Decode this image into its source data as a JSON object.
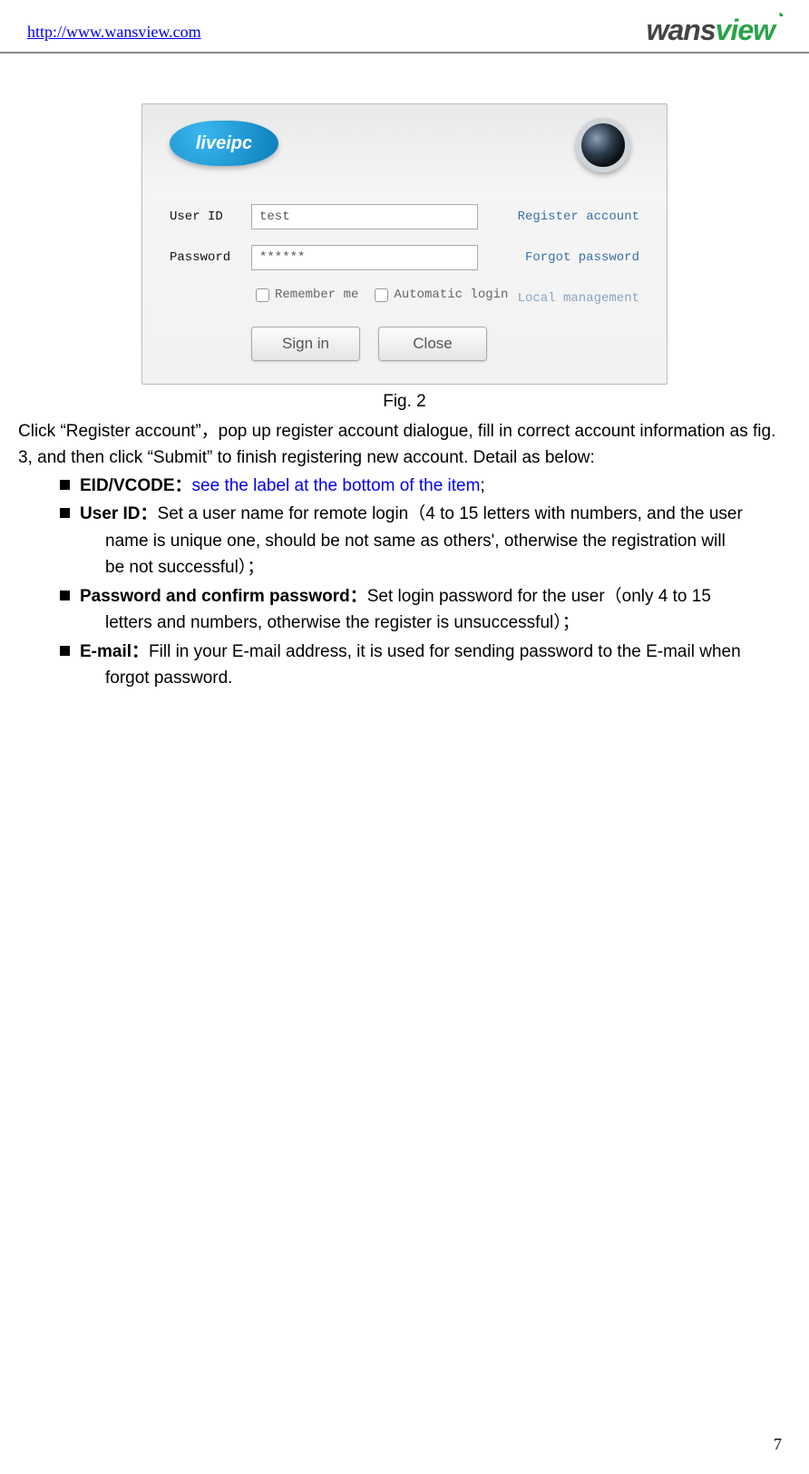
{
  "header": {
    "url": "http://www.wansview.com",
    "brand_prefix": "wans",
    "brand_suffix": "view"
  },
  "login": {
    "badge": "liveipc",
    "user_label": "User  ID",
    "user_value": "test",
    "pass_label": "Password",
    "pass_value": "******",
    "register_link": "Register account",
    "forgot_link": "Forgot password",
    "remember": "Remember me",
    "auto": "Automatic login",
    "local": "Local management",
    "signin": "Sign in",
    "close": "Close"
  },
  "caption": "Fig. 2",
  "para1": "Click “Register account”，pop up register account dialogue, fill in correct account information as fig. 3, and then click “Submit” to finish registering new account. Detail as below:",
  "bullets": {
    "b1_label": "EID/VCODE：",
    "b1_link": "see the label at the bottom of the item",
    "b1_tail": ";",
    "b2_label": "User ID：",
    "b2_text1": "Set a user name for remote login（4 to 15 letters with numbers, and the user",
    "b2_text2": "name is unique one, should be not same as others', otherwise the registration will",
    "b2_text3": "be not successful）；",
    "b3_label": "Password and confirm password：",
    "b3_text1": "Set login password for the user（only 4 to 15",
    "b3_text2": "letters and numbers, otherwise the register is unsuccessful）；",
    "b4_label": "E-mail：",
    "b4_text1": "Fill in your E-mail address, it is used for sending password to the E-mail when",
    "b4_text2": "forgot password."
  },
  "page_number": "7"
}
